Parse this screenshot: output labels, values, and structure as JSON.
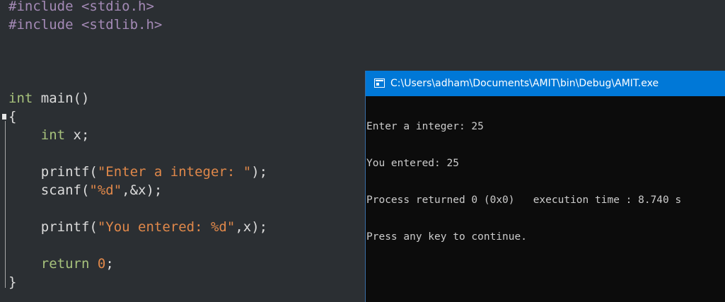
{
  "editor": {
    "lines": {
      "l1": {
        "directive": "#include",
        "header": "<stdio.h>"
      },
      "l2": {
        "directive": "#include",
        "header": "<stdlib.h>"
      },
      "l3": {
        "type": "int",
        "rest": "main()"
      },
      "l4": {
        "brace": "{"
      },
      "l5": {
        "type": "int",
        "rest": "x;"
      },
      "l6": {
        "fn": "printf(",
        "str": "\"Enter a integer: \"",
        "tail": ");"
      },
      "l7": {
        "fn": "scanf(",
        "str": "\"%d\"",
        "tail": ",&x);"
      },
      "l8": {
        "fn": "printf(",
        "str": "\"You entered: %d\"",
        "tail": ",x);"
      },
      "l9": {
        "kw": "return",
        "num": "0",
        "tail": ";"
      },
      "l10": {
        "brace": "}"
      }
    }
  },
  "console": {
    "title": "C:\\Users\\adham\\Documents\\AMIT\\bin\\Debug\\AMIT.exe",
    "output": [
      "Enter a integer: 25",
      "You entered: 25",
      "Process returned 0 (0x0)   execution time : 8.740 s",
      "Press any key to continue."
    ]
  },
  "colors": {
    "editor_background": "#2b2f33",
    "console_background": "#0c0c0c",
    "titlebar": "#0078d7",
    "preprocessor": "#a48ab6",
    "keyword": "#a7c27c",
    "string": "#e0884a"
  }
}
